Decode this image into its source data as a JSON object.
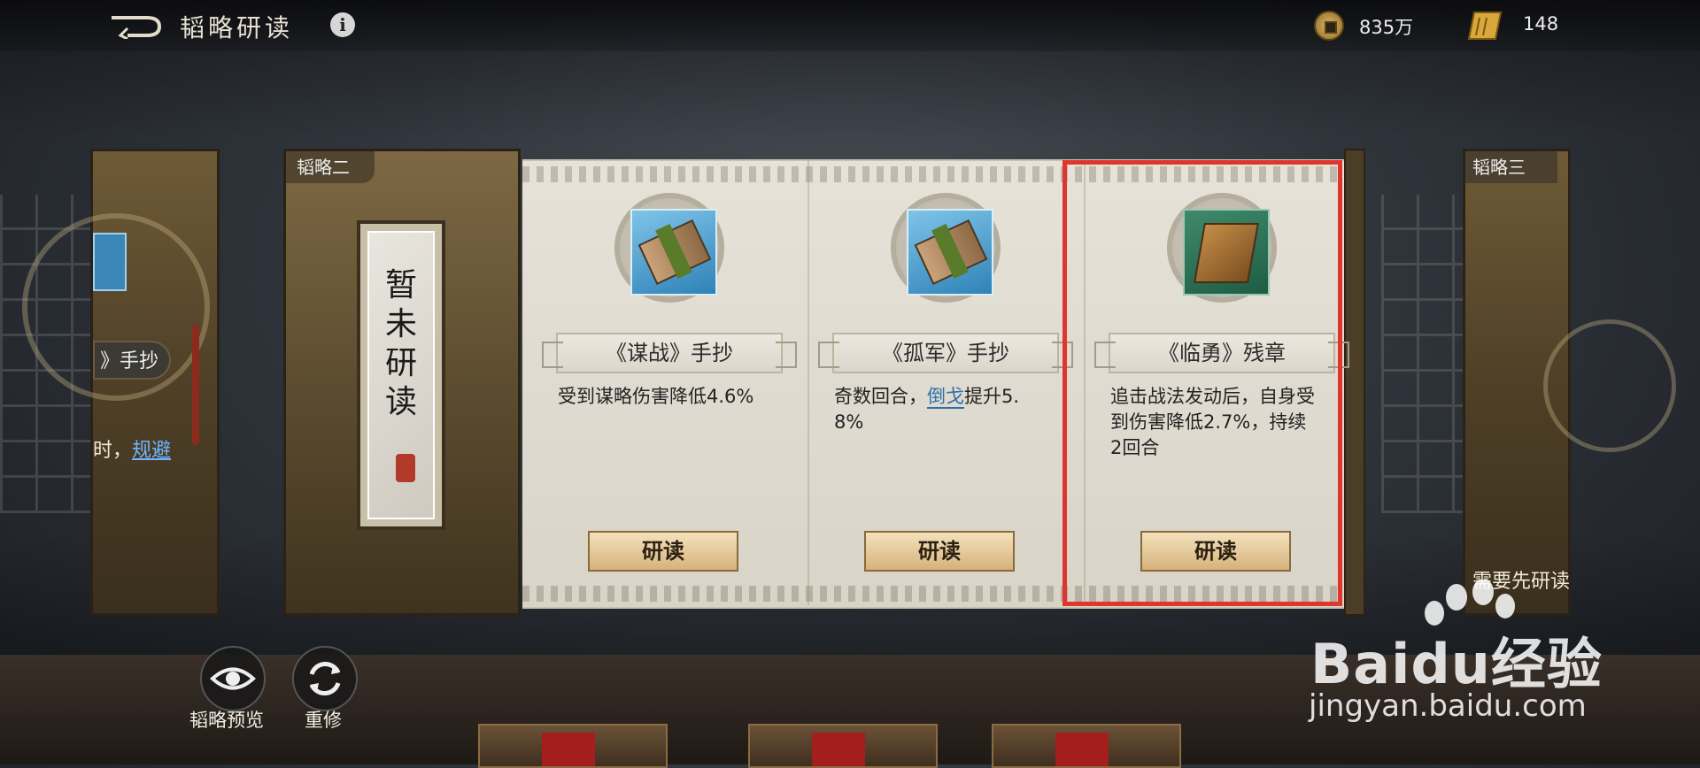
{
  "topbar": {
    "title": "韬略研读",
    "info_icon": "i",
    "coins": "835万",
    "scrolls": "148"
  },
  "left_panel": {
    "pill_text": "》手抄",
    "desc_prefix": "时，",
    "desc_link": "规避"
  },
  "right_panel": {
    "tier": "韬略三",
    "note": "需要先研读"
  },
  "main_panel": {
    "tier": "韬略二",
    "plaque_text": "暂未研读"
  },
  "cards": [
    {
      "title": "《谋战》手抄",
      "desc_parts": [
        "受到谋略伤害降低4.6%"
      ],
      "button": "研读",
      "icon": "bundled-book-icon"
    },
    {
      "title": "《孤军》手抄",
      "desc_before": "奇数回合，",
      "desc_link": "倒戈",
      "desc_after": "提升5.8%",
      "button": "研读",
      "icon": "bundled-book-icon"
    },
    {
      "title": "《临勇》残章",
      "desc_parts": [
        "追击战法发动后，自身受到伤害降低2.7%，持续2回合"
      ],
      "button": "研读",
      "icon": "bound-book-icon"
    }
  ],
  "bottom_buttons": {
    "preview_label": "韬略预览",
    "reset_label": "重修"
  },
  "watermark": {
    "brand": "Baidu经验",
    "url": "jingyan.baidu.com"
  },
  "colors": {
    "highlight": "#e0352f",
    "link_blue": "#2f6fa8",
    "gold": "#d6b27c"
  }
}
